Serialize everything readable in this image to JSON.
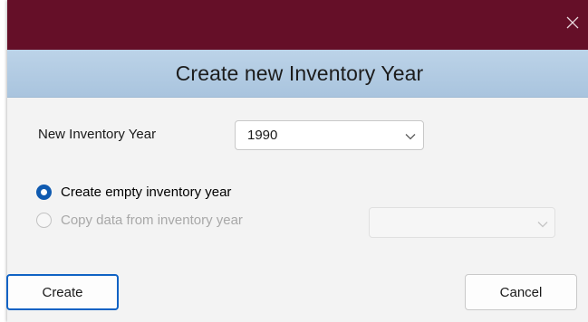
{
  "window": {
    "close_icon": "close-icon",
    "titlebar_color": "#650f28"
  },
  "header": {
    "title": "Create new Inventory Year"
  },
  "form": {
    "new_year_label": "New Inventory Year",
    "new_year_value": "1990",
    "options": [
      {
        "label": "Create empty inventory year",
        "selected": true,
        "enabled": true
      },
      {
        "label": "Copy data from inventory year",
        "selected": false,
        "enabled": false
      }
    ],
    "copy_from_value": ""
  },
  "buttons": {
    "create_label": "Create",
    "cancel_label": "Cancel"
  },
  "colors": {
    "accent": "#0f5ab0",
    "header_band": "#b4cce3"
  }
}
